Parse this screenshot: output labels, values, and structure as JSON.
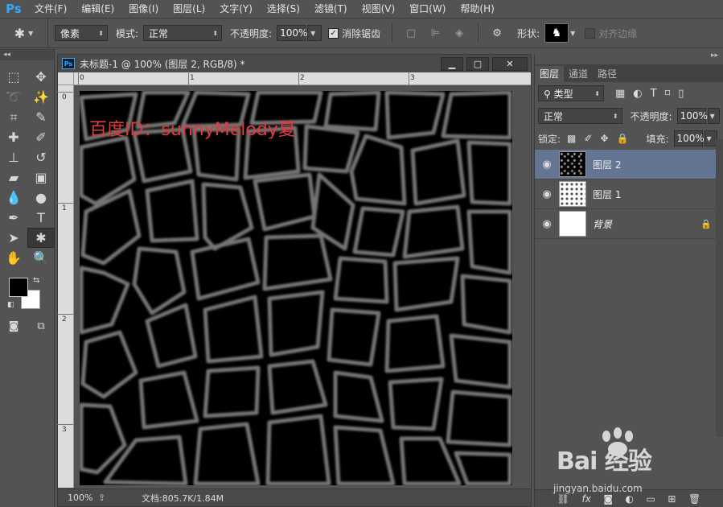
{
  "app": {
    "logo": "Ps"
  },
  "menu": [
    "文件(F)",
    "编辑(E)",
    "图像(I)",
    "图层(L)",
    "文字(Y)",
    "选择(S)",
    "滤镜(T)",
    "视图(V)",
    "窗口(W)",
    "帮助(H)"
  ],
  "options": {
    "pixels_value": "像素",
    "mode_label": "模式:",
    "mode_value": "正常",
    "opacity_label": "不透明度:",
    "opacity_value": "100%",
    "antialias_label": "消除锯齿",
    "shape_label": "形状:",
    "align_edges_label": "对齐边缘"
  },
  "document": {
    "title": "未标题-1 @ 100% (图层 2, RGB/8) *",
    "ruler_h": [
      "0",
      "1",
      "2",
      "3"
    ],
    "ruler_v": [
      "0",
      "1",
      "2",
      "3"
    ],
    "watermark": "百度ID：sunnyMelody夏",
    "zoom": "100%",
    "doc_size": "文档:805.7K/1.84M"
  },
  "layers_panel": {
    "tabs": [
      "图层",
      "通道",
      "路径"
    ],
    "filter_kind": "类型",
    "blend_mode": "正常",
    "opacity_label": "不透明度:",
    "opacity_value": "100%",
    "lock_label": "锁定:",
    "fill_label": "填充:",
    "fill_value": "100%",
    "layers": [
      {
        "name": "图层 2",
        "selected": true
      },
      {
        "name": "图层 1",
        "selected": false
      },
      {
        "name": "背景",
        "selected": false
      }
    ],
    "footer_fx": "fx"
  },
  "baidu": {
    "logo": "Bai 经验",
    "url": "jingyan.baidu.com"
  }
}
